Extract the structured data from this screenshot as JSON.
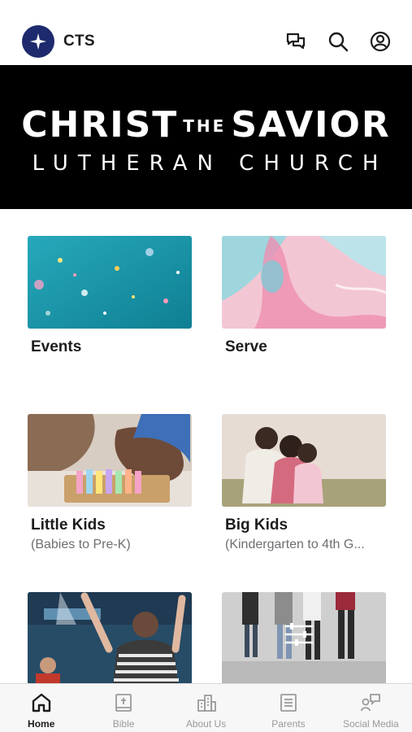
{
  "header": {
    "app_title": "CTS",
    "icons": [
      "chat-icon",
      "search-icon",
      "profile-icon"
    ]
  },
  "banner": {
    "line1_a": "CHRIST",
    "line1_small": "THE",
    "line1_b": "SAVIOR",
    "line2": "LUTHERAN CHURCH"
  },
  "cards": [
    {
      "title": "Events",
      "subtitle": ""
    },
    {
      "title": "Serve",
      "subtitle": ""
    },
    {
      "title": "Little Kids",
      "subtitle": "(Babies to Pre-K)"
    },
    {
      "title": "Big Kids",
      "subtitle": "(Kindergarten to 4th G..."
    },
    {
      "title": "",
      "subtitle": ""
    },
    {
      "title": "",
      "subtitle": ""
    }
  ],
  "tabbar": {
    "active": "Home",
    "tabs": [
      {
        "label": "Home",
        "icon": "home-icon"
      },
      {
        "label": "Bible",
        "icon": "bible-icon"
      },
      {
        "label": "About Us",
        "icon": "buildings-icon"
      },
      {
        "label": "Parents",
        "icon": "document-icon"
      },
      {
        "label": "Social Media",
        "icon": "social-icon"
      }
    ]
  },
  "colors": {
    "logo_bg": "#1d2a6d",
    "banner_bg": "#000000",
    "tab_active": "#1c1c1e",
    "tab_inactive": "#9a9a9a"
  }
}
